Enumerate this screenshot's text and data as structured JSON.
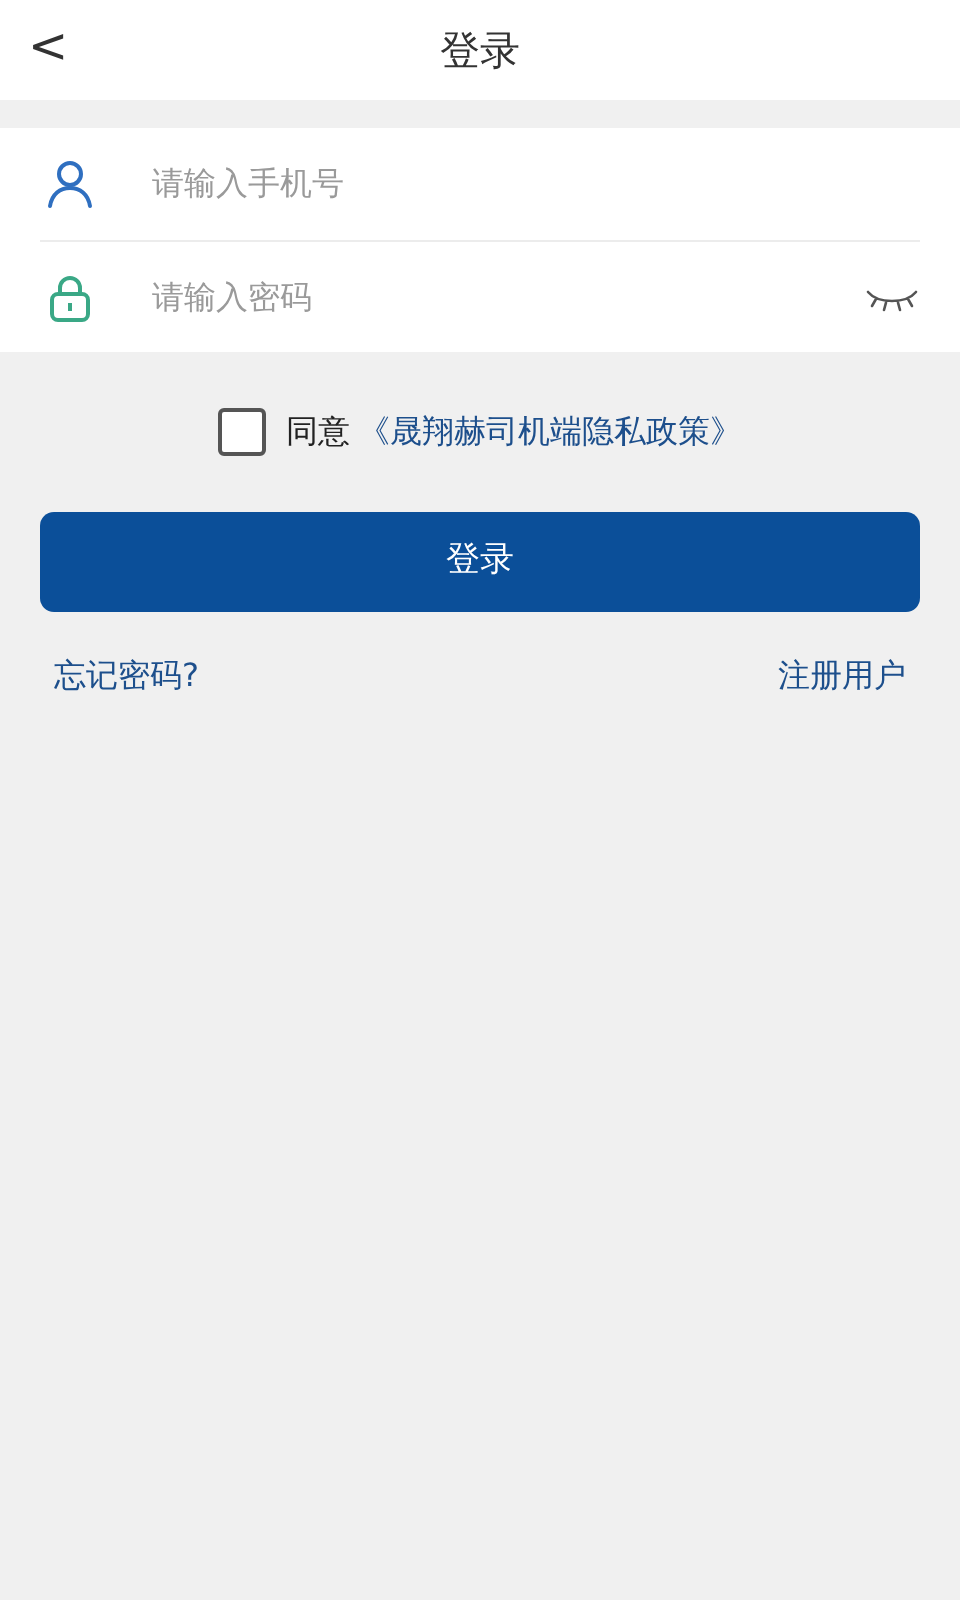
{
  "header": {
    "back": "<",
    "title": "登录"
  },
  "fields": [
    {
      "kind": "phone",
      "placeholder": "请输入手机号"
    },
    {
      "kind": "password",
      "placeholder": "请输入密码",
      "visible": false
    }
  ],
  "agreement": {
    "checked": false,
    "label": "同意",
    "link": "《晟翔赫司机端隐私政策》"
  },
  "login_button": "登录",
  "links": {
    "forgot": "忘记密码?",
    "register": "注册用户"
  }
}
